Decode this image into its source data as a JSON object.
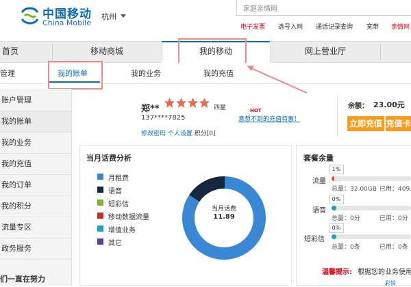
{
  "header": {
    "logo_cn": "中国移动",
    "logo_en": "China Mobile",
    "city": "杭州",
    "search_placeholder": "家庭亲情网",
    "top_links": [
      "电子发票",
      "选号入网",
      "通话记录查询",
      "宽带",
      "亲情网"
    ]
  },
  "nav": {
    "items": [
      "首页",
      "移动商城",
      "我的移动",
      "网上营业厅"
    ],
    "active": "我的移动"
  },
  "subnav": {
    "items": [
      "管理",
      "我的账单",
      "我的业务",
      "我的充值"
    ],
    "active": "我的账单"
  },
  "sidebar": {
    "items": [
      "账户管理",
      "我的账单",
      "我的业务",
      "我的充值",
      "我的订单",
      "我的积分",
      "流量专区",
      "政务服务"
    ],
    "footer": "们一直在努力"
  },
  "user": {
    "name": "郑**",
    "stars_label": "四星",
    "star_count": 4,
    "phone": "137****7825",
    "link_change_password": "修改密码",
    "link_settings": "个人设置",
    "points": "积分[0]",
    "hot_tag": "HOT",
    "promo": "意想不到的充值特惠！",
    "balance_label": "余额：",
    "balance_value": "23.00元",
    "btn_recharge": "立即充值",
    "btn_card": "充值卡"
  },
  "bill": {
    "title": "当月话费分析",
    "center_label": "当月话费",
    "center_value": "11.89",
    "legend": [
      {
        "label": "月租费",
        "color": "#3a87d6"
      },
      {
        "label": "语音",
        "color": "#13273d"
      },
      {
        "label": "短彩信",
        "color": "#7cb82f"
      },
      {
        "label": "移动数据流量",
        "color": "#c9302c"
      },
      {
        "label": "增值业务",
        "color": "#17a7c9"
      },
      {
        "label": "其它",
        "color": "#5b3f8f"
      }
    ]
  },
  "chart_data": {
    "type": "pie",
    "categories": [
      "月租费",
      "语音",
      "短彩信",
      "移动数据流量",
      "增值业务",
      "其它"
    ],
    "values": [
      0.84,
      0.16,
      0,
      0,
      0,
      0
    ],
    "total": 11.89
  },
  "package": {
    "title": "套餐余量",
    "items": [
      {
        "name": "流量",
        "percent": "1%",
        "fraction": 0.01,
        "detail_total": "总量：32.00GB",
        "detail_used": "已用：409."
      },
      {
        "name": "语音",
        "percent": "0%",
        "fraction": 0,
        "detail_total": "总量：0分",
        "detail_used": "已用：0分"
      },
      {
        "name": "短彩信",
        "percent": "0%",
        "fraction": 0,
        "detail_total": "总量：0条",
        "detail_used": "已用：0条"
      }
    ],
    "tip_label": "温馨提示:",
    "tip_text": "根据您的业务使用",
    "bottom_text": "彩铃"
  }
}
